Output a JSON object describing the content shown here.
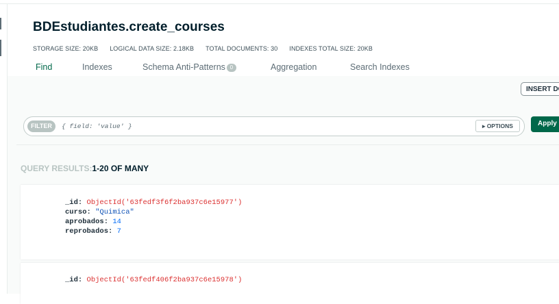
{
  "collection": {
    "title": "BDEstudiantes.create_courses"
  },
  "stats": [
    {
      "label": "STORAGE SIZE:",
      "value": "20KB"
    },
    {
      "label": "LOGICAL DATA SIZE:",
      "value": "2.18KB"
    },
    {
      "label": "TOTAL DOCUMENTS:",
      "value": "30"
    },
    {
      "label": "INDEXES TOTAL SIZE:",
      "value": "20KB"
    }
  ],
  "tabs": [
    {
      "label": "Find",
      "active": true
    },
    {
      "label": "Indexes"
    },
    {
      "label": "Schema Anti-Patterns",
      "badge": "0"
    },
    {
      "label": "Aggregation"
    },
    {
      "label": "Search Indexes"
    }
  ],
  "toolbar": {
    "insert_label": "INSERT DOCUMENT"
  },
  "filter": {
    "pill_label": "FILTER",
    "placeholder": "{ field: 'value' }",
    "options_label": "OPTIONS",
    "apply_label": "Apply"
  },
  "results": {
    "label": "QUERY RESULTS:",
    "range": "1-20 OF MANY"
  },
  "documents": [
    {
      "id_key": "_id:",
      "id_value": "ObjectId('63fedf3f6f2ba937c6e15977')",
      "curso_key": "curso:",
      "curso_value": "\"Quimica\"",
      "aprobados_key": "aprobados:",
      "aprobados_value": "14",
      "reprobados_key": "reprobados:",
      "reprobados_value": "7"
    },
    {
      "id_key": "_id:",
      "id_value": "ObjectId('63fedf406f2ba937c6e15978')"
    }
  ],
  "colors": {
    "accent_green": "#00684a",
    "objectid_red": "#db3030",
    "string_blue": "#1254b7",
    "number_blue": "#016bf8"
  }
}
